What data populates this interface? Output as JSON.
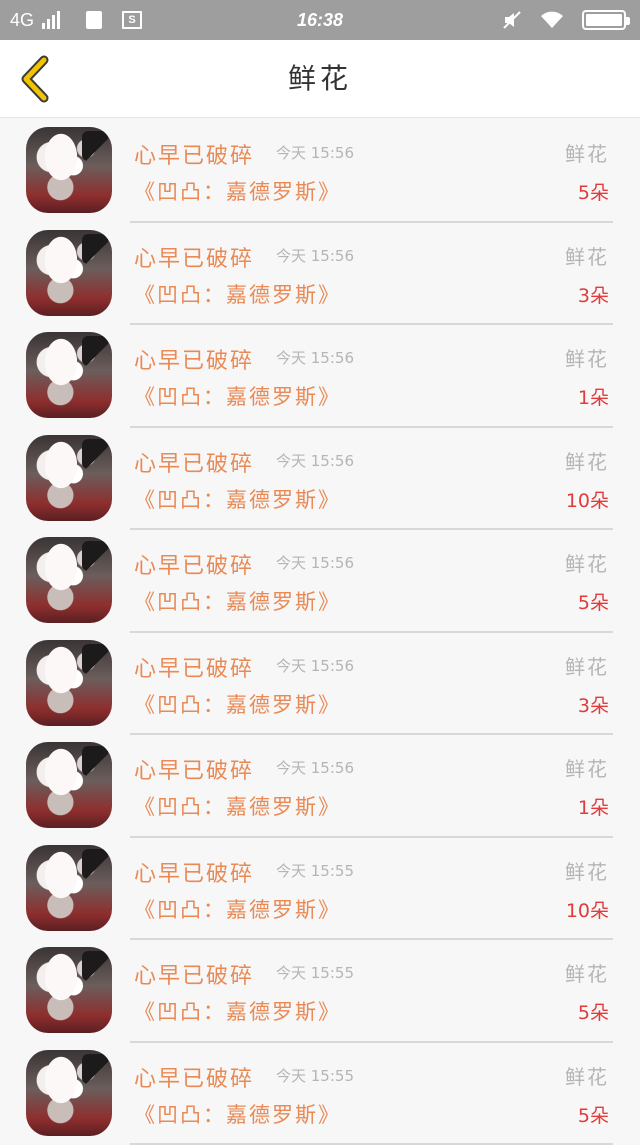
{
  "status_bar": {
    "network": "4G",
    "time": "16:38",
    "screenshot_icon_text": "S"
  },
  "header": {
    "title": "鲜花"
  },
  "items": [
    {
      "sender": "心早已破碎",
      "time": "今天 15:56",
      "gift_type": "鲜花",
      "book": "《凹凸：嘉德罗斯》",
      "count": "5朵"
    },
    {
      "sender": "心早已破碎",
      "time": "今天 15:56",
      "gift_type": "鲜花",
      "book": "《凹凸：嘉德罗斯》",
      "count": "3朵"
    },
    {
      "sender": "心早已破碎",
      "time": "今天 15:56",
      "gift_type": "鲜花",
      "book": "《凹凸：嘉德罗斯》",
      "count": "1朵"
    },
    {
      "sender": "心早已破碎",
      "time": "今天 15:56",
      "gift_type": "鲜花",
      "book": "《凹凸：嘉德罗斯》",
      "count": "10朵"
    },
    {
      "sender": "心早已破碎",
      "time": "今天 15:56",
      "gift_type": "鲜花",
      "book": "《凹凸：嘉德罗斯》",
      "count": "5朵"
    },
    {
      "sender": "心早已破碎",
      "time": "今天 15:56",
      "gift_type": "鲜花",
      "book": "《凹凸：嘉德罗斯》",
      "count": "3朵"
    },
    {
      "sender": "心早已破碎",
      "time": "今天 15:56",
      "gift_type": "鲜花",
      "book": "《凹凸：嘉德罗斯》",
      "count": "1朵"
    },
    {
      "sender": "心早已破碎",
      "time": "今天 15:55",
      "gift_type": "鲜花",
      "book": "《凹凸：嘉德罗斯》",
      "count": "10朵"
    },
    {
      "sender": "心早已破碎",
      "time": "今天 15:55",
      "gift_type": "鲜花",
      "book": "《凹凸：嘉德罗斯》",
      "count": "5朵"
    },
    {
      "sender": "心早已破碎",
      "time": "今天 15:55",
      "gift_type": "鲜花",
      "book": "《凹凸：嘉德罗斯》",
      "count": "5朵"
    }
  ],
  "colors": {
    "accent_orange": "#e98a55",
    "count_red": "#e23b3b",
    "muted_gray": "#b5b5b5",
    "status_bar": "#9e9e9e",
    "back_arrow": "#f2c400"
  }
}
